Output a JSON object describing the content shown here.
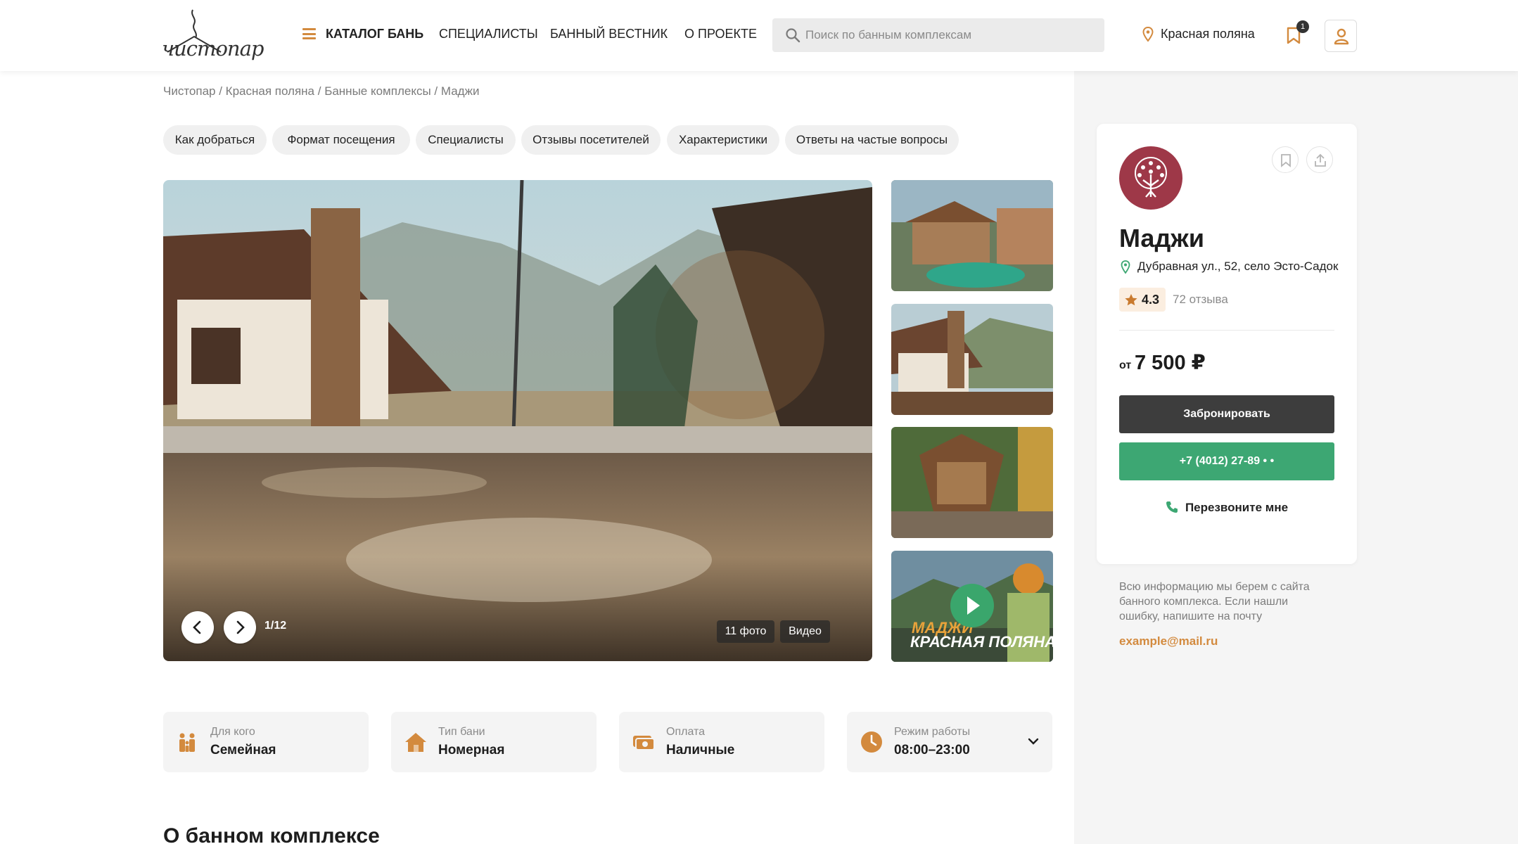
{
  "header": {
    "logo_text": "чистопар",
    "catalog": "КАТАЛОГ БАНЬ",
    "specialists": "СПЕЦИАЛИСТЫ",
    "bulletin": "БАННЫЙ ВЕСТНИК",
    "about": "О ПРОЕКТЕ",
    "search_placeholder": "Поиск по банным комплексам",
    "location": "Красная поляна",
    "bookmarks_count": "1"
  },
  "breadcrumbs": {
    "items": [
      "Чистопар",
      "Красная поляна",
      "Банные комплексы",
      "Маджи"
    ],
    "sep": " / "
  },
  "chips": [
    "Как добраться",
    "Формат посещения",
    "Специалисты",
    "Отзывы посетителей",
    "Характеристики",
    "Ответы на частые вопросы"
  ],
  "gallery": {
    "counter": "1/12",
    "photos_label": "11 фото",
    "video_label": "Видео",
    "video_thumb_title": "МАДЖИ",
    "video_thumb_sub": "КРАСНАЯ ПОЛЯНА"
  },
  "info_cards": [
    {
      "label": "Для кого",
      "value": "Семейная",
      "icon": "family-icon"
    },
    {
      "label": "Тип бани",
      "value": "Номерная",
      "icon": "house-icon"
    },
    {
      "label": "Оплата",
      "value": "Наличные",
      "icon": "cash-icon"
    },
    {
      "label": "Режим работы",
      "value": "08:00–23:00",
      "icon": "clock-icon"
    }
  ],
  "section_title": "О банном комплексе",
  "venue": {
    "name": "Маджи",
    "address": "Дубравная ул., 52, село Эсто-Садок",
    "rating": "4.3",
    "reviews": "72 отзыва",
    "price_prefix": "от",
    "price": "7 500 ₽",
    "book_label": "Забронировать",
    "phone_label": "+7 (4012) 27-89 • •",
    "callback_label": "Перезвоните мне"
  },
  "note": {
    "text": "Всю информацию мы берем с сайта банного комплекса. Если нашли ошибку, напишите на почту",
    "email": "example@mail.ru"
  },
  "colors": {
    "accent": "#d38a3e",
    "green": "#3da773",
    "brand": "#9e3848",
    "dark_button": "#3d3d3d"
  }
}
